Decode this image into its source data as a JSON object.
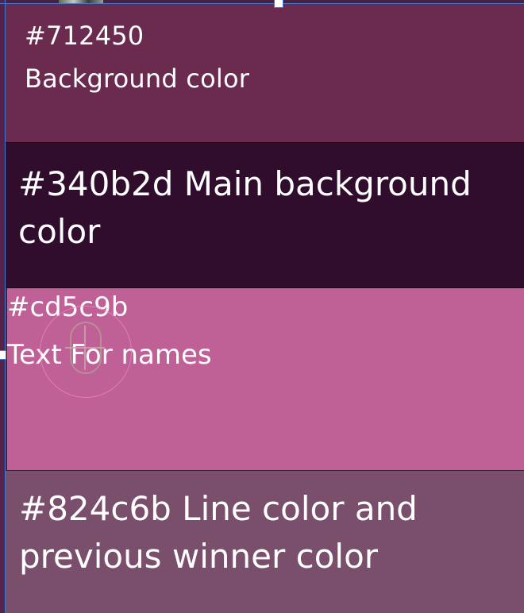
{
  "swatches": [
    {
      "hex": "#712450",
      "description": "Background color",
      "fill": "#6a2b4f"
    },
    {
      "hex": "#340b2d",
      "description": "Main background color",
      "text": "#340b2d Main background color",
      "fill": "#300d2d"
    },
    {
      "hex": "#cd5c9b",
      "description": "Text For names",
      "fill": "#bf6096"
    },
    {
      "hex": "#824c6b",
      "description": "Line color and previous winner color",
      "text": "#824c6b Line color and previous winner color",
      "fill": "#7a4f6b"
    }
  ],
  "colors": {
    "selection": "#3e7bd6"
  }
}
